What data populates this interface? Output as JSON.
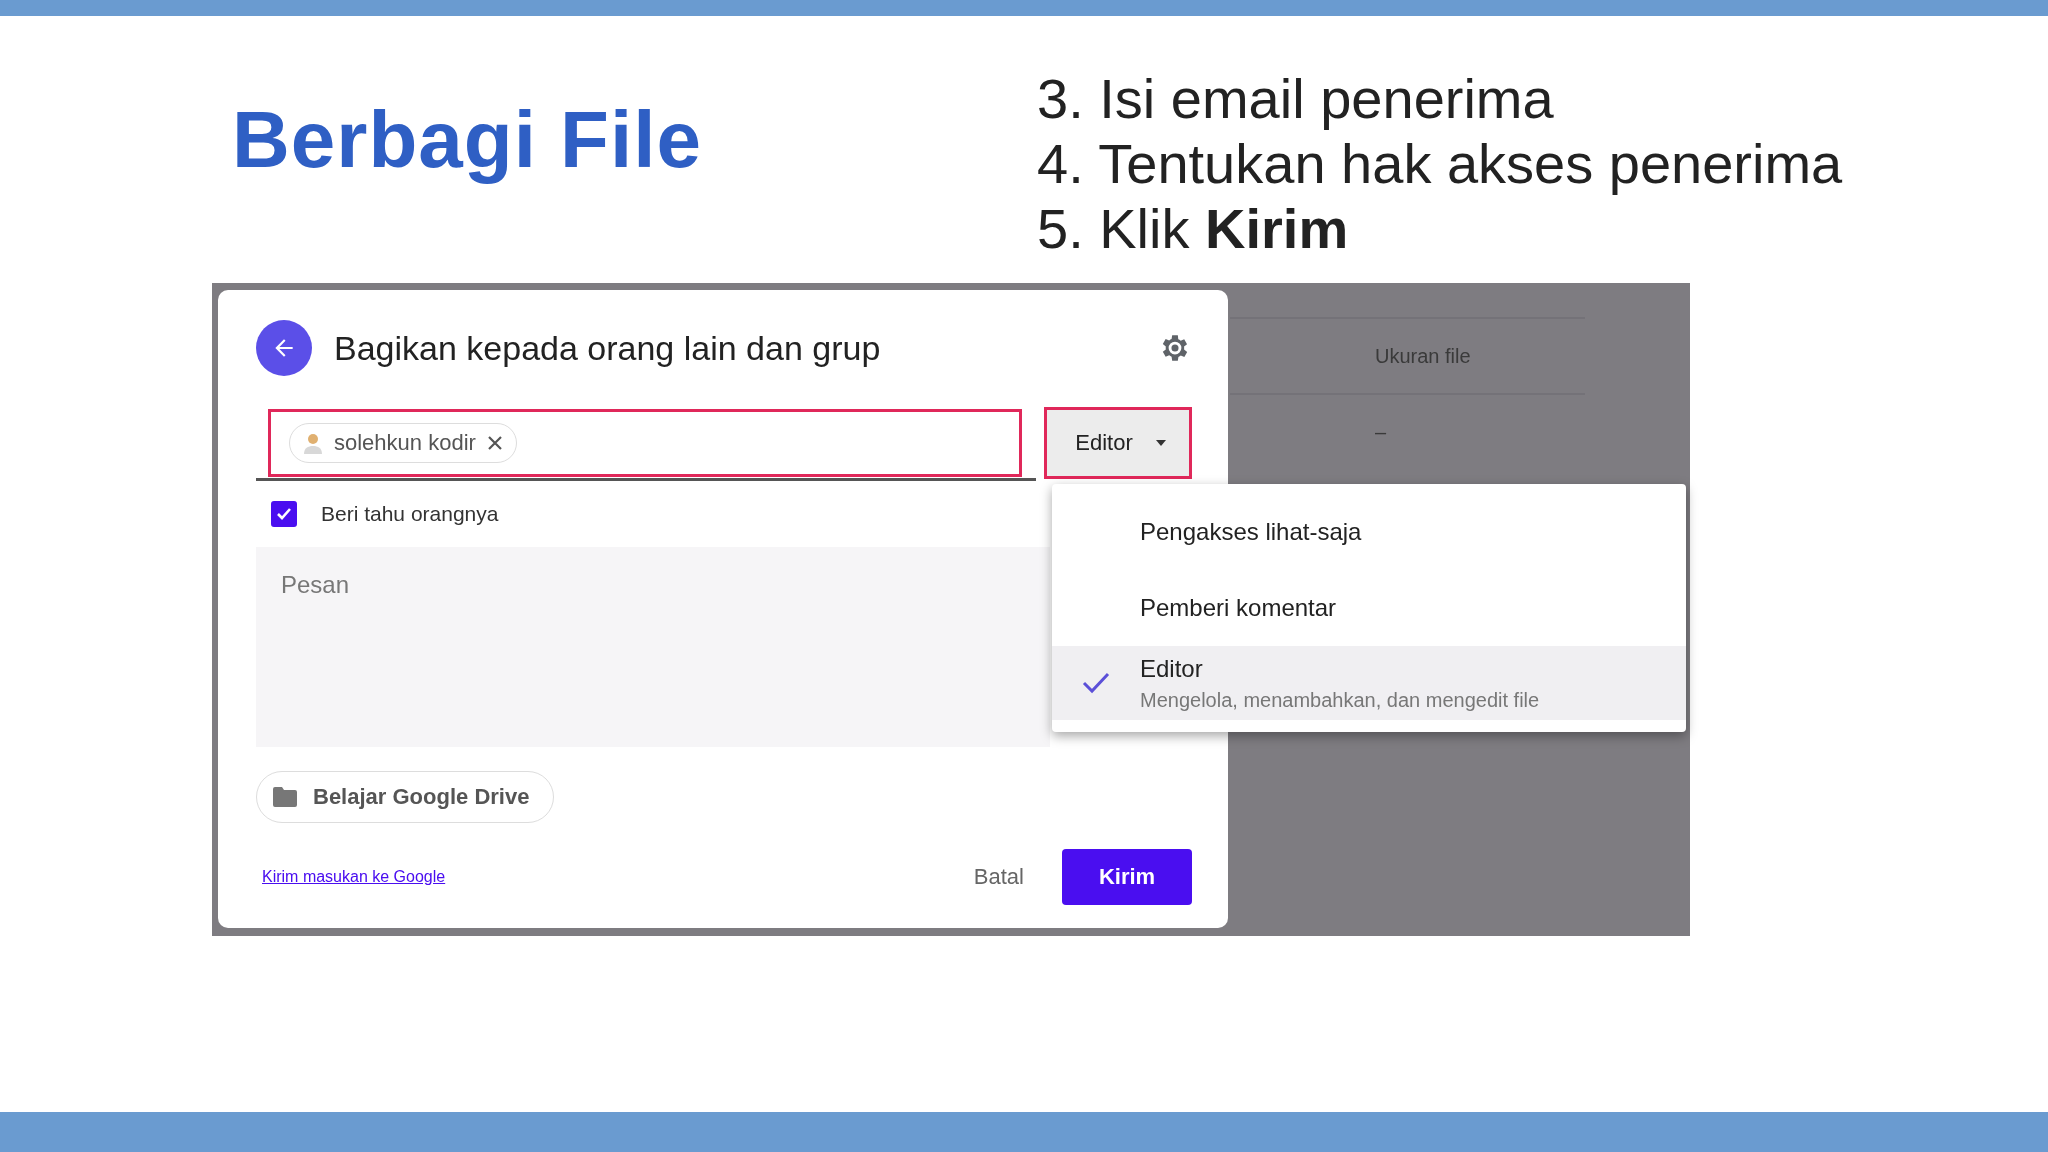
{
  "slide": {
    "title": "Berbagi File",
    "steps": [
      "3. Isi email penerima",
      "4. Tentukan hak akses penerima",
      "5. Klik **Kirim**"
    ]
  },
  "screenshot": {
    "background": {
      "column_header": "Ukuran file",
      "cell": "–"
    },
    "dialog": {
      "title": "Bagikan kepada orang lain dan grup",
      "recipients": [
        {
          "name": "solehkun kodir"
        }
      ],
      "role_button": "Editor",
      "notify": {
        "label": "Beri tahu orangnya",
        "checked": true
      },
      "message": {
        "placeholder": "Pesan"
      },
      "folder": "Belajar Google Drive",
      "feedback_link": "Kirim masukan ke Google",
      "cancel": "Batal",
      "send": "Kirim"
    },
    "role_menu": [
      {
        "label": "Pengakses lihat-saja",
        "selected": false
      },
      {
        "label": "Pemberi komentar",
        "selected": false
      },
      {
        "label": "Editor",
        "description": "Mengelola, menambahkan, dan mengedit file",
        "selected": true
      }
    ]
  }
}
